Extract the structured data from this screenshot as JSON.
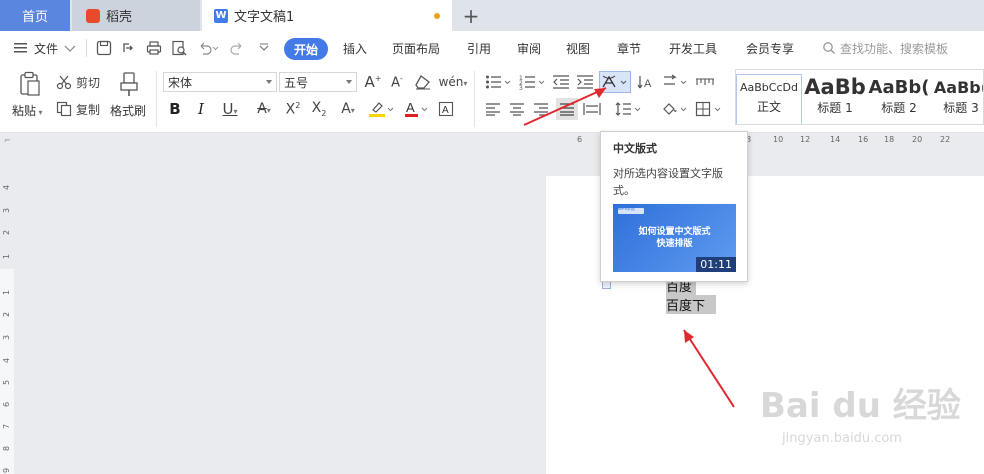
{
  "tabs": {
    "home": "首页",
    "daoke": "稻壳",
    "doc": "文字文稿1",
    "add": "+"
  },
  "menu": {
    "file": "文件",
    "start": "开始",
    "insert": "插入",
    "layout": "页面布局",
    "reference": "引用",
    "review": "审阅",
    "view": "视图",
    "chapter": "章节",
    "devtools": "开发工具",
    "vip": "会员专享",
    "search": "查找功能、搜索模板"
  },
  "ribbon": {
    "paste": "粘贴",
    "cut": "剪切",
    "copy": "复制",
    "format_painter": "格式刷",
    "font_name": "宋体",
    "font_size": "五号",
    "styles": [
      {
        "sample": "AaBbCcDd",
        "name": "正文"
      },
      {
        "sample": "AaBb",
        "name": "标题 1"
      },
      {
        "sample": "AaBb(",
        "name": "标题 2"
      },
      {
        "sample": "AaBb(",
        "name": "标题 3"
      }
    ]
  },
  "ruler": {
    "top": [
      "6",
      "8",
      "10",
      "12",
      "14",
      "16",
      "18",
      "20",
      "22"
    ],
    "left": [
      "4",
      "3",
      "2",
      "1",
      "1",
      "2",
      "3",
      "4",
      "5",
      "6",
      "7",
      "8",
      "9"
    ]
  },
  "document": {
    "line1": "百度",
    "line2": "百度下"
  },
  "tooltip": {
    "title": "中文版式",
    "desc": "对所选内容设置文字版式。",
    "video_logo": "WPS学院",
    "video_title_1": "如何设置中文版式",
    "video_title_2": "快速排版",
    "duration": "01:11"
  },
  "watermark": {
    "main": "Bai du 经验",
    "sub": "jingyan.baidu.com"
  },
  "colors": {
    "accent": "#4479e8",
    "home_tab": "#5b86e0",
    "arrow": "#e0282e",
    "highlight_yellow": "#f5d800",
    "font_red": "#e02020"
  }
}
